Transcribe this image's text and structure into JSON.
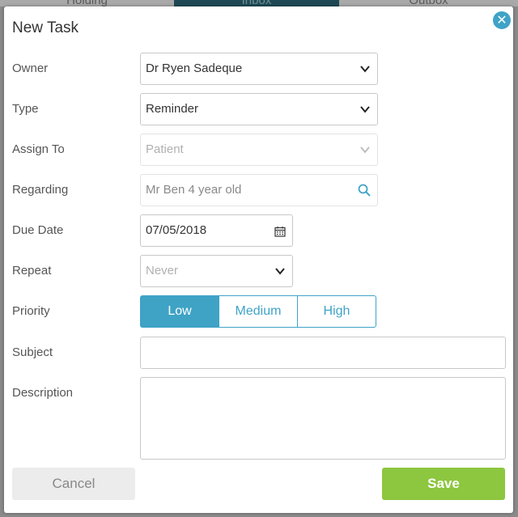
{
  "background_tabs": [
    "Holding",
    "Inbox",
    "Outbox"
  ],
  "dialog": {
    "title": "New Task",
    "close_symbol": "✕"
  },
  "form": {
    "owner": {
      "label": "Owner",
      "value": "Dr Ryen Sadeque"
    },
    "type": {
      "label": "Type",
      "value": "Reminder"
    },
    "assign_to": {
      "label": "Assign To",
      "placeholder": "Patient",
      "disabled": true
    },
    "regarding": {
      "label": "Regarding",
      "value": "Mr Ben  4 year old"
    },
    "due_date": {
      "label": "Due Date",
      "value": "07/05/2018"
    },
    "repeat": {
      "label": "Repeat",
      "placeholder": "Never"
    },
    "priority": {
      "label": "Priority",
      "options": [
        "Low",
        "Medium",
        "High"
      ],
      "selected": "Low"
    },
    "subject": {
      "label": "Subject",
      "value": ""
    },
    "description": {
      "label": "Description",
      "value": ""
    }
  },
  "actions": {
    "cancel_label": "Cancel",
    "save_label": "Save"
  },
  "colors": {
    "accent": "#3fa3c6",
    "save": "#8dc63f",
    "cancel_bg": "#ececec"
  },
  "icons": [
    "close-icon",
    "chevron-down-icon",
    "search-icon",
    "calendar-icon"
  ]
}
